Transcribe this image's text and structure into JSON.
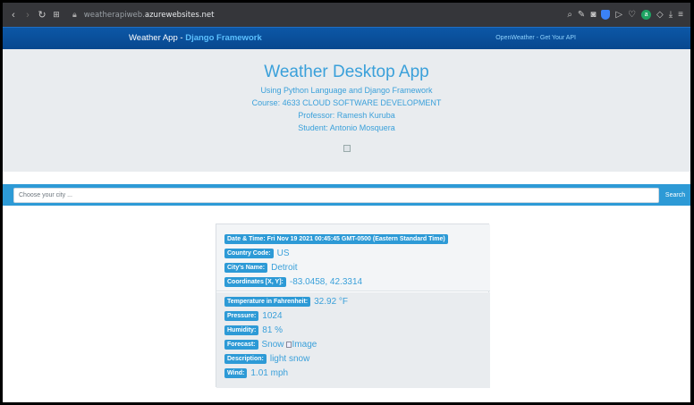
{
  "browser": {
    "url_prefix": "weatherapiweb.",
    "url_host": "azurewebsites.net",
    "extension_badge": "a"
  },
  "navbar": {
    "brand": "Weather App - ",
    "brand_highlight": "Django Framework",
    "right_link": "OpenWeather - Get Your API"
  },
  "hero": {
    "title": "Weather Desktop App",
    "lines": [
      "Using Python Language and Django Framework",
      "Course: 4633 CLOUD SOFTWARE DEVELOPMENT",
      "Professor: Ramesh Kuruba",
      "Student: Antonio Mosquera"
    ]
  },
  "search": {
    "placeholder": "Choose your city ...",
    "button": "Search"
  },
  "weather": {
    "datetime_label": "Date & Time: Fri Nov 19 2021 00:45:45 GMT-0500 (Eastern Standard Time)",
    "country_label": "Country Code:",
    "country": "US",
    "city_label": "City's Name:",
    "city": "Detroit",
    "coords_label": "Coordinates [X, Y]:",
    "coords": "-83.0458, 42.3314",
    "temp_label": "Temperature in Fahrenheit:",
    "temp": "32.92 °F",
    "pressure_label": "Pressure:",
    "pressure": "1024",
    "humidity_label": "Humidity:",
    "humidity": "81 %",
    "forecast_label": "Forecast:",
    "forecast": "Snow",
    "forecast_img_alt": "Image",
    "description_label": "Description:",
    "description": "light snow",
    "wind_label": "Wind:",
    "wind": "1.01 mph"
  }
}
